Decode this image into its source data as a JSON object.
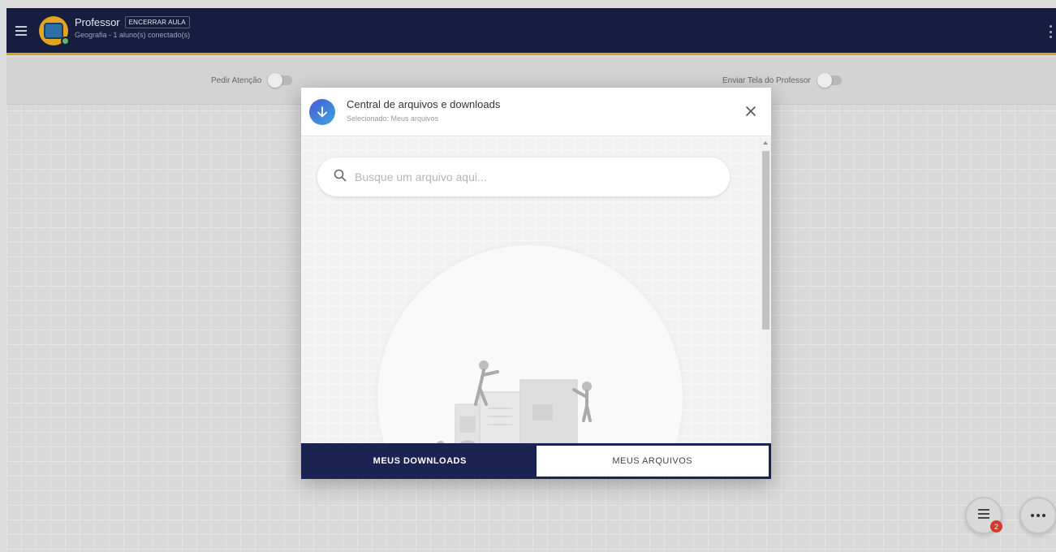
{
  "header": {
    "teacher_name": "Professor",
    "end_class_label": "ENCERRAR AULA",
    "subtitle": "Geografia - 1 aluno(s) conectado(s)"
  },
  "toolbar": {
    "request_attention_label": "Pedir Atenção",
    "request_attention_on": false,
    "send_screen_label": "Enviar Tela do Professor",
    "send_screen_on": false
  },
  "modal": {
    "title": "Central de arquivos e downloads",
    "selected_label": "Selecionado: Meus arquivos",
    "search_placeholder": "Busque um arquivo aqui...",
    "tabs": [
      {
        "label": "MEUS DOWNLOADS",
        "active": false
      },
      {
        "label": "MEUS ARQUIVOS",
        "active": true
      }
    ]
  },
  "fabs": {
    "list_badge_count": "2"
  },
  "colors": {
    "topbar": "#161d3f",
    "accent_gold": "#d9a520",
    "footer_navy": "#1a2352",
    "badge_red": "#d23a2f"
  }
}
